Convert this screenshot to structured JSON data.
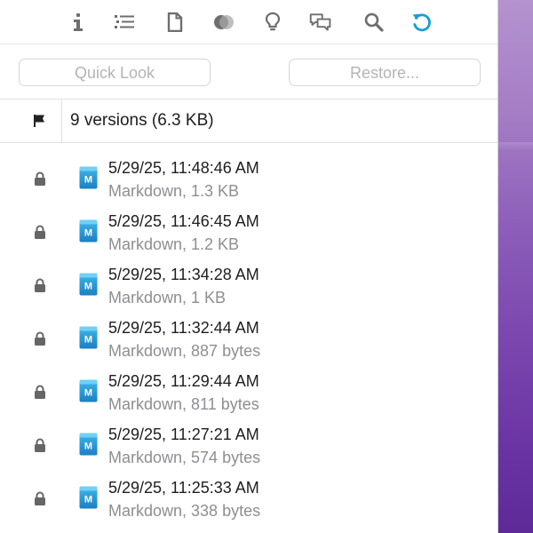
{
  "toolbar": {
    "icons": [
      "info-icon",
      "list-icon",
      "document-icon",
      "color-circles-icon",
      "lightbulb-icon",
      "comments-icon",
      "search-icon",
      "version-history-icon"
    ],
    "active_icon": "version-history-icon",
    "active_color": "#1a9bd7"
  },
  "actions": {
    "quick_look_label": "Quick Look",
    "restore_label": "Restore..."
  },
  "versions": {
    "header_icon": "flag-icon",
    "summary": "9 versions (6.3 KB)",
    "items": [
      {
        "date": "5/29/25, 11:48:46 AM",
        "meta": "Markdown, 1.3 KB"
      },
      {
        "date": "5/29/25, 11:46:45 AM",
        "meta": "Markdown, 1.2 KB"
      },
      {
        "date": "5/29/25, 11:34:28 AM",
        "meta": "Markdown, 1 KB"
      },
      {
        "date": "5/29/25, 11:32:44 AM",
        "meta": "Markdown, 887 bytes"
      },
      {
        "date": "5/29/25, 11:29:44 AM",
        "meta": "Markdown, 811 bytes"
      },
      {
        "date": "5/29/25, 11:27:21 AM",
        "meta": "Markdown, 574 bytes"
      },
      {
        "date": "5/29/25, 11:25:33 AM",
        "meta": "Markdown, 338 bytes"
      }
    ],
    "file_icon_label": "M",
    "file_icon_color": "#1b8fd0"
  }
}
